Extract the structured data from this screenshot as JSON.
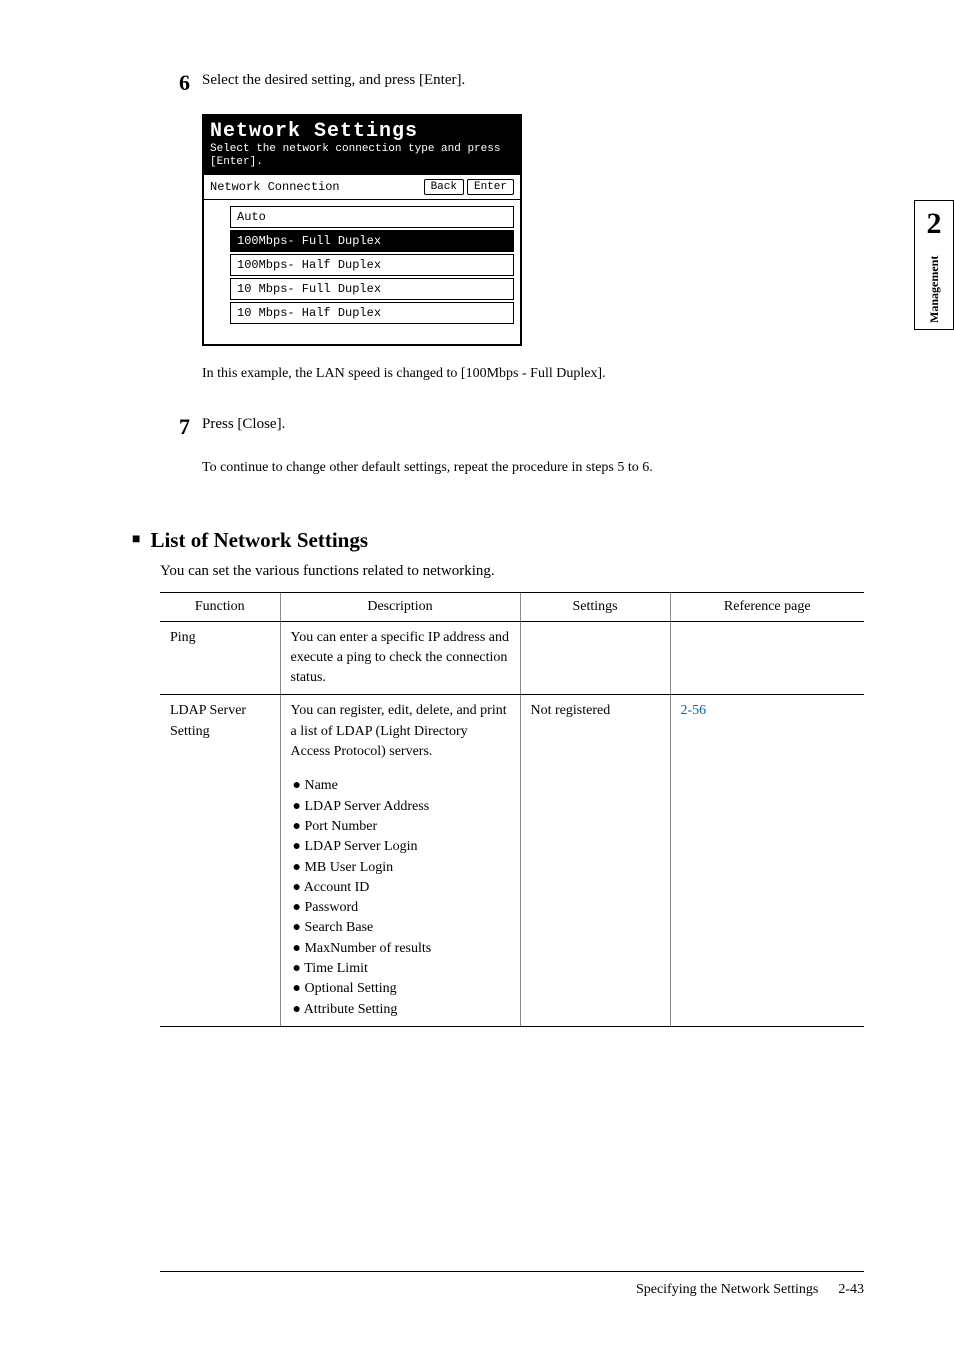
{
  "side_tab": {
    "chapter_num": "2",
    "label": "Management"
  },
  "steps": {
    "s6": {
      "num": "6",
      "text": "Select the desired setting, and press [Enter].",
      "after": "In this example, the LAN speed is changed to [100Mbps - Full Duplex]."
    },
    "s7": {
      "num": "7",
      "text": "Press [Close].",
      "after": "To continue to change other default settings, repeat the procedure in steps 5 to 6."
    }
  },
  "screenshot": {
    "title": "Network Settings",
    "subtitle": "Select the network connection type and press [Enter].",
    "label": "Network Connection",
    "back_btn": "Back",
    "enter_btn": "Enter",
    "options": [
      "Auto",
      "100Mbps- Full Duplex",
      "100Mbps- Half Duplex",
      "10 Mbps- Full Duplex",
      "10 Mbps- Half Duplex"
    ]
  },
  "section": {
    "title": "List of Network Settings",
    "text": "You can set the various functions related to networking."
  },
  "table": {
    "headers": {
      "function": "Function",
      "description": "Description",
      "settings": "Settings",
      "reference": "Reference page"
    },
    "row1": {
      "function": "Ping",
      "description": "You can enter a specific IP address and execute a ping to check the connection status.",
      "settings": "",
      "reference": ""
    },
    "row2": {
      "function": "LDAP Server Setting",
      "description_main": "You can register, edit, delete, and print a list of LDAP (Light Directory Access Protocol) servers.",
      "bullets": [
        "Name",
        "LDAP Server Address",
        "Port Number",
        "LDAP Server Login",
        "MB User Login",
        "Account ID",
        "Password",
        "Search Base",
        "MaxNumber of results",
        "Time Limit",
        "Optional Setting",
        "Attribute Setting"
      ],
      "settings": "Not registered",
      "reference": "2-56"
    }
  },
  "footer": {
    "title": "Specifying the Network Settings",
    "page": "2-43"
  }
}
